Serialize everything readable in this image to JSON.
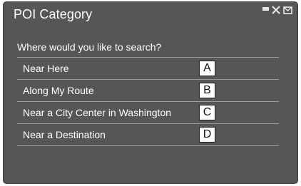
{
  "header": {
    "title": "POI Category",
    "status_icons": [
      "signal-icon",
      "connection-icon",
      "mail-icon"
    ]
  },
  "prompt": "Where would you like to search?",
  "options": [
    {
      "label": "Near Here",
      "callout": "A"
    },
    {
      "label": "Along My Route",
      "callout": "B"
    },
    {
      "label": "Near a City Center in Washington",
      "callout": "C"
    },
    {
      "label": "Near a Destination",
      "callout": "D"
    }
  ],
  "colors": {
    "screen_background": "#565656",
    "text": "#ffffff",
    "divider": "#9b9b9b",
    "callout_background": "#ffffff",
    "callout_border": "#222222"
  }
}
